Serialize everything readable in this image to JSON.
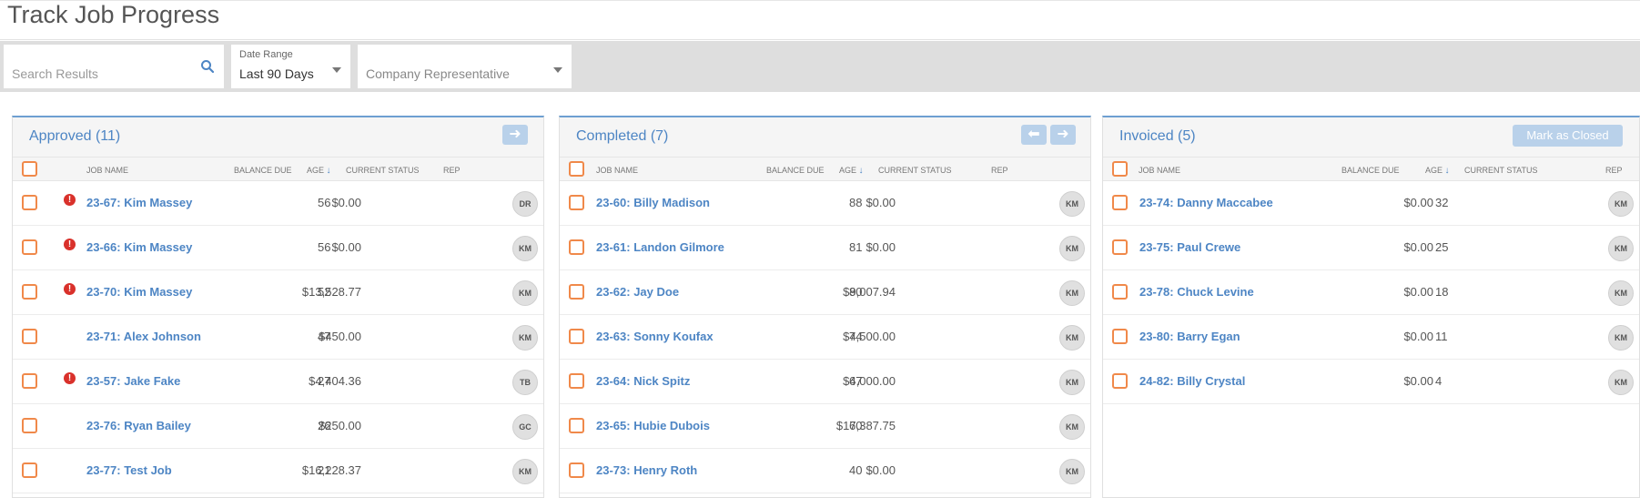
{
  "page": {
    "title": "Track Job Progress"
  },
  "filters": {
    "search_placeholder": "Search Results",
    "date_range_label": "Date Range",
    "date_range_value": "Last 90 Days",
    "rep_value": "Company Representative"
  },
  "columns": {
    "job_name": "JOB NAME",
    "balance_due": "BALANCE DUE",
    "age": "AGE",
    "current_status": "CURRENT STATUS",
    "rep": "REP"
  },
  "icons": {
    "search": "search-icon",
    "alert": "alert-icon",
    "arrow_right": "arrow-right-icon",
    "arrow_left": "arrow-left-icon",
    "sort_down": "sort-down-icon"
  },
  "colors": {
    "accent": "#4d85c4",
    "alert": "#d9312b",
    "checkbox": "#f0894a",
    "button_disabled": "#b9d1ea"
  },
  "panels": [
    {
      "title": "Approved (11)",
      "rows": [
        {
          "alert": true,
          "job": "23-67: Kim Massey",
          "balance": "$0.00",
          "age": "56",
          "rep": "DR"
        },
        {
          "alert": true,
          "job": "23-66: Kim Massey",
          "balance": "$0.00",
          "age": "56",
          "rep": "KM"
        },
        {
          "alert": true,
          "job": "23-70: Kim Massey",
          "balance": "$13,528.77",
          "age": "52",
          "rep": "KM"
        },
        {
          "alert": false,
          "job": "23-71: Alex Johnson",
          "balance": "$450.00",
          "age": "47",
          "rep": "KM"
        },
        {
          "alert": true,
          "job": "23-57: Jake Fake",
          "balance": "$4,404.36",
          "age": "27",
          "rep": "TB"
        },
        {
          "alert": false,
          "job": "23-76: Ryan Bailey",
          "balance": "$250.00",
          "age": "26",
          "rep": "GC"
        },
        {
          "alert": false,
          "job": "23-77: Test Job",
          "balance": "$16,228.37",
          "age": "21",
          "rep": "KM"
        }
      ]
    },
    {
      "title": "Completed (7)",
      "rows": [
        {
          "alert": false,
          "job": "23-60: Billy Madison",
          "balance": "$0.00",
          "age": "88",
          "rep": "KM"
        },
        {
          "alert": false,
          "job": "23-61: Landon Gilmore",
          "balance": "$0.00",
          "age": "81",
          "rep": "KM"
        },
        {
          "alert": false,
          "job": "23-62: Jay Doe",
          "balance": "$9,007.94",
          "age": "80",
          "rep": "KM"
        },
        {
          "alert": false,
          "job": "23-63: Sonny Koufax",
          "balance": "$4,500.00",
          "age": "74",
          "rep": "KM"
        },
        {
          "alert": false,
          "job": "23-64: Nick Spitz",
          "balance": "$4,000.00",
          "age": "67",
          "rep": "KM"
        },
        {
          "alert": false,
          "job": "23-65: Hubie Dubois",
          "balance": "$17,387.75",
          "age": "60",
          "rep": "KM"
        },
        {
          "alert": false,
          "job": "23-73: Henry Roth",
          "balance": "$0.00",
          "age": "40",
          "rep": "KM"
        }
      ]
    },
    {
      "title": "Invoiced (5)",
      "close_label": "Mark as Closed",
      "rows": [
        {
          "alert": false,
          "job": "23-74: Danny Maccabee",
          "balance": "$0.00",
          "age": "32",
          "rep": "KM"
        },
        {
          "alert": false,
          "job": "23-75: Paul Crewe",
          "balance": "$0.00",
          "age": "25",
          "rep": "KM"
        },
        {
          "alert": false,
          "job": "23-78: Chuck Levine",
          "balance": "$0.00",
          "age": "18",
          "rep": "KM"
        },
        {
          "alert": false,
          "job": "23-80: Barry Egan",
          "balance": "$0.00",
          "age": "11",
          "rep": "KM"
        },
        {
          "alert": false,
          "job": "24-82: Billy Crystal",
          "balance": "$0.00",
          "age": "4",
          "rep": "KM"
        }
      ]
    }
  ]
}
